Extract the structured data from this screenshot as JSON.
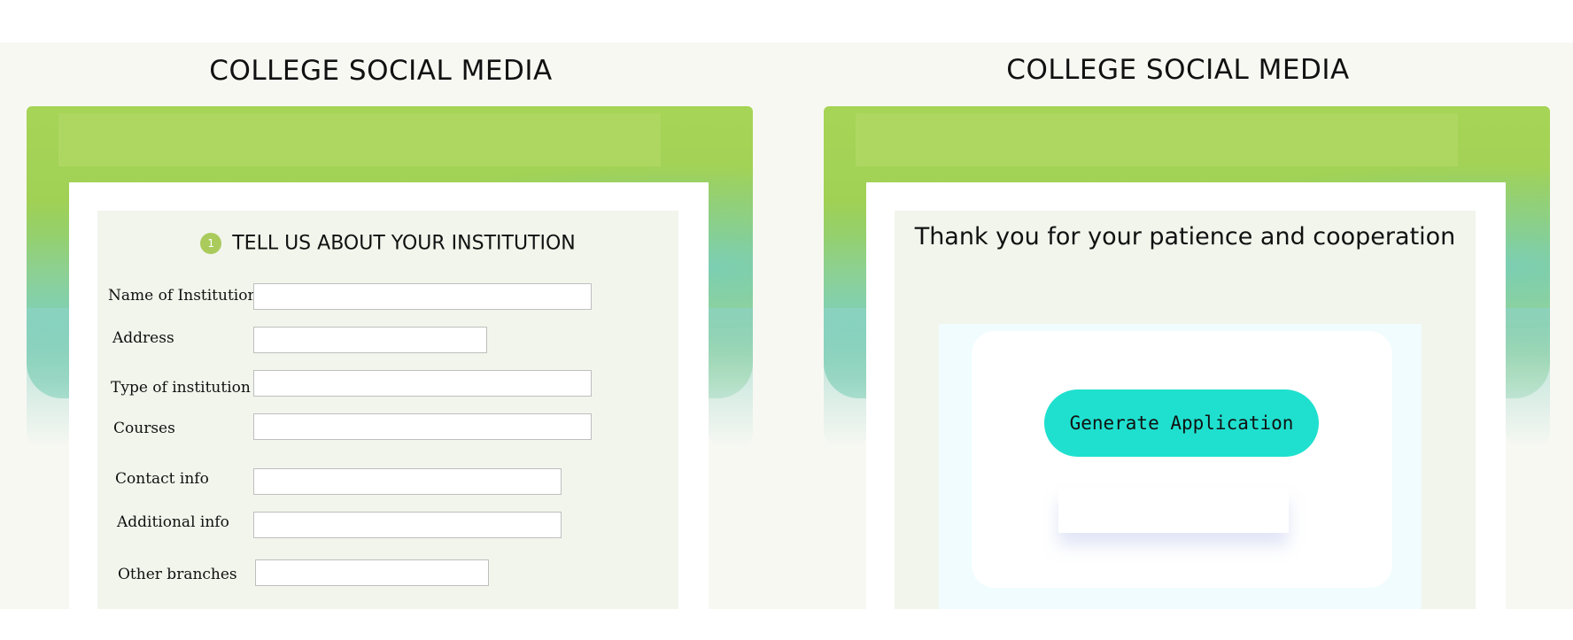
{
  "left_panel": {
    "site_title": "COLLEGE SOCIAL MEDIA",
    "section": {
      "step_number": "1",
      "heading": "TELL US ABOUT YOUR INSTITUTION"
    },
    "fields": [
      {
        "label": "Name of Institution",
        "value": ""
      },
      {
        "label": "Address",
        "value": ""
      },
      {
        "label": "Type of institution",
        "value": ""
      },
      {
        "label": "Courses",
        "value": ""
      },
      {
        "label": "Contact info",
        "value": ""
      },
      {
        "label": "Additional info",
        "value": ""
      },
      {
        "label": "Other branches",
        "value": ""
      }
    ]
  },
  "right_panel": {
    "site_title": "COLLEGE SOCIAL MEDIA",
    "thanks_message": "Thank you for your patience and cooperation",
    "generate_button_label": "Generate Application"
  },
  "colors": {
    "accent_green": "#aacb5c",
    "button_teal": "#1fe0cf",
    "card_bg": "#f2f5ec"
  }
}
